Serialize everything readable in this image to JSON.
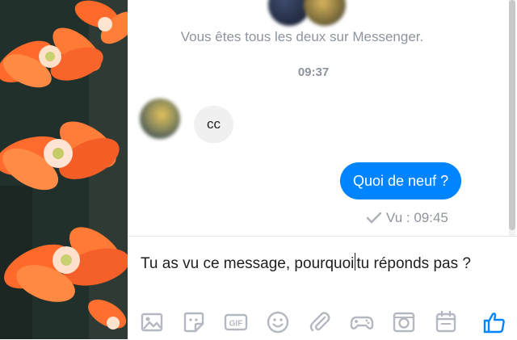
{
  "conversation": {
    "info_text": "Vous êtes tous les deux sur Messenger.",
    "time_stamp": "09:37",
    "messages": [
      {
        "from": "contact",
        "text": "cc"
      },
      {
        "from": "me",
        "text": "Quoi de neuf ?"
      }
    ],
    "seen_label": "Vu : 09:45"
  },
  "composer": {
    "text_before_caret": "Tu as vu ce message, pourquoi",
    "text_after_caret": "tu réponds pas ?"
  },
  "toolbar": {
    "icons": [
      "image-icon",
      "sticker-icon",
      "gif-icon",
      "emoji-icon",
      "attachment-icon",
      "game-icon",
      "camera-icon",
      "calendar-icon",
      "like-icon"
    ],
    "gif_label": "GIF"
  },
  "colors": {
    "accent": "#0084ff",
    "incoming_bubble": "#f1f0f0",
    "muted_text": "#8d949e",
    "toolbar_icon": "#b4b8c0"
  }
}
